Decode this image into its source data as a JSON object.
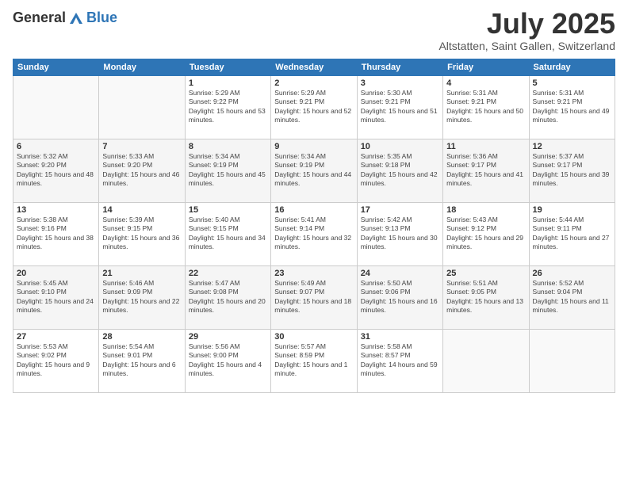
{
  "logo": {
    "general": "General",
    "blue": "Blue"
  },
  "header": {
    "month": "July 2025",
    "location": "Altstatten, Saint Gallen, Switzerland"
  },
  "weekdays": [
    "Sunday",
    "Monday",
    "Tuesday",
    "Wednesday",
    "Thursday",
    "Friday",
    "Saturday"
  ],
  "weeks": [
    [
      {
        "day": "",
        "sunrise": "",
        "sunset": "",
        "daylight": ""
      },
      {
        "day": "",
        "sunrise": "",
        "sunset": "",
        "daylight": ""
      },
      {
        "day": "1",
        "sunrise": "Sunrise: 5:29 AM",
        "sunset": "Sunset: 9:22 PM",
        "daylight": "Daylight: 15 hours and 53 minutes."
      },
      {
        "day": "2",
        "sunrise": "Sunrise: 5:29 AM",
        "sunset": "Sunset: 9:21 PM",
        "daylight": "Daylight: 15 hours and 52 minutes."
      },
      {
        "day": "3",
        "sunrise": "Sunrise: 5:30 AM",
        "sunset": "Sunset: 9:21 PM",
        "daylight": "Daylight: 15 hours and 51 minutes."
      },
      {
        "day": "4",
        "sunrise": "Sunrise: 5:31 AM",
        "sunset": "Sunset: 9:21 PM",
        "daylight": "Daylight: 15 hours and 50 minutes."
      },
      {
        "day": "5",
        "sunrise": "Sunrise: 5:31 AM",
        "sunset": "Sunset: 9:21 PM",
        "daylight": "Daylight: 15 hours and 49 minutes."
      }
    ],
    [
      {
        "day": "6",
        "sunrise": "Sunrise: 5:32 AM",
        "sunset": "Sunset: 9:20 PM",
        "daylight": "Daylight: 15 hours and 48 minutes."
      },
      {
        "day": "7",
        "sunrise": "Sunrise: 5:33 AM",
        "sunset": "Sunset: 9:20 PM",
        "daylight": "Daylight: 15 hours and 46 minutes."
      },
      {
        "day": "8",
        "sunrise": "Sunrise: 5:34 AM",
        "sunset": "Sunset: 9:19 PM",
        "daylight": "Daylight: 15 hours and 45 minutes."
      },
      {
        "day": "9",
        "sunrise": "Sunrise: 5:34 AM",
        "sunset": "Sunset: 9:19 PM",
        "daylight": "Daylight: 15 hours and 44 minutes."
      },
      {
        "day": "10",
        "sunrise": "Sunrise: 5:35 AM",
        "sunset": "Sunset: 9:18 PM",
        "daylight": "Daylight: 15 hours and 42 minutes."
      },
      {
        "day": "11",
        "sunrise": "Sunrise: 5:36 AM",
        "sunset": "Sunset: 9:17 PM",
        "daylight": "Daylight: 15 hours and 41 minutes."
      },
      {
        "day": "12",
        "sunrise": "Sunrise: 5:37 AM",
        "sunset": "Sunset: 9:17 PM",
        "daylight": "Daylight: 15 hours and 39 minutes."
      }
    ],
    [
      {
        "day": "13",
        "sunrise": "Sunrise: 5:38 AM",
        "sunset": "Sunset: 9:16 PM",
        "daylight": "Daylight: 15 hours and 38 minutes."
      },
      {
        "day": "14",
        "sunrise": "Sunrise: 5:39 AM",
        "sunset": "Sunset: 9:15 PM",
        "daylight": "Daylight: 15 hours and 36 minutes."
      },
      {
        "day": "15",
        "sunrise": "Sunrise: 5:40 AM",
        "sunset": "Sunset: 9:15 PM",
        "daylight": "Daylight: 15 hours and 34 minutes."
      },
      {
        "day": "16",
        "sunrise": "Sunrise: 5:41 AM",
        "sunset": "Sunset: 9:14 PM",
        "daylight": "Daylight: 15 hours and 32 minutes."
      },
      {
        "day": "17",
        "sunrise": "Sunrise: 5:42 AM",
        "sunset": "Sunset: 9:13 PM",
        "daylight": "Daylight: 15 hours and 30 minutes."
      },
      {
        "day": "18",
        "sunrise": "Sunrise: 5:43 AM",
        "sunset": "Sunset: 9:12 PM",
        "daylight": "Daylight: 15 hours and 29 minutes."
      },
      {
        "day": "19",
        "sunrise": "Sunrise: 5:44 AM",
        "sunset": "Sunset: 9:11 PM",
        "daylight": "Daylight: 15 hours and 27 minutes."
      }
    ],
    [
      {
        "day": "20",
        "sunrise": "Sunrise: 5:45 AM",
        "sunset": "Sunset: 9:10 PM",
        "daylight": "Daylight: 15 hours and 24 minutes."
      },
      {
        "day": "21",
        "sunrise": "Sunrise: 5:46 AM",
        "sunset": "Sunset: 9:09 PM",
        "daylight": "Daylight: 15 hours and 22 minutes."
      },
      {
        "day": "22",
        "sunrise": "Sunrise: 5:47 AM",
        "sunset": "Sunset: 9:08 PM",
        "daylight": "Daylight: 15 hours and 20 minutes."
      },
      {
        "day": "23",
        "sunrise": "Sunrise: 5:49 AM",
        "sunset": "Sunset: 9:07 PM",
        "daylight": "Daylight: 15 hours and 18 minutes."
      },
      {
        "day": "24",
        "sunrise": "Sunrise: 5:50 AM",
        "sunset": "Sunset: 9:06 PM",
        "daylight": "Daylight: 15 hours and 16 minutes."
      },
      {
        "day": "25",
        "sunrise": "Sunrise: 5:51 AM",
        "sunset": "Sunset: 9:05 PM",
        "daylight": "Daylight: 15 hours and 13 minutes."
      },
      {
        "day": "26",
        "sunrise": "Sunrise: 5:52 AM",
        "sunset": "Sunset: 9:04 PM",
        "daylight": "Daylight: 15 hours and 11 minutes."
      }
    ],
    [
      {
        "day": "27",
        "sunrise": "Sunrise: 5:53 AM",
        "sunset": "Sunset: 9:02 PM",
        "daylight": "Daylight: 15 hours and 9 minutes."
      },
      {
        "day": "28",
        "sunrise": "Sunrise: 5:54 AM",
        "sunset": "Sunset: 9:01 PM",
        "daylight": "Daylight: 15 hours and 6 minutes."
      },
      {
        "day": "29",
        "sunrise": "Sunrise: 5:56 AM",
        "sunset": "Sunset: 9:00 PM",
        "daylight": "Daylight: 15 hours and 4 minutes."
      },
      {
        "day": "30",
        "sunrise": "Sunrise: 5:57 AM",
        "sunset": "Sunset: 8:59 PM",
        "daylight": "Daylight: 15 hours and 1 minute."
      },
      {
        "day": "31",
        "sunrise": "Sunrise: 5:58 AM",
        "sunset": "Sunset: 8:57 PM",
        "daylight": "Daylight: 14 hours and 59 minutes."
      },
      {
        "day": "",
        "sunrise": "",
        "sunset": "",
        "daylight": ""
      },
      {
        "day": "",
        "sunrise": "",
        "sunset": "",
        "daylight": ""
      }
    ]
  ]
}
